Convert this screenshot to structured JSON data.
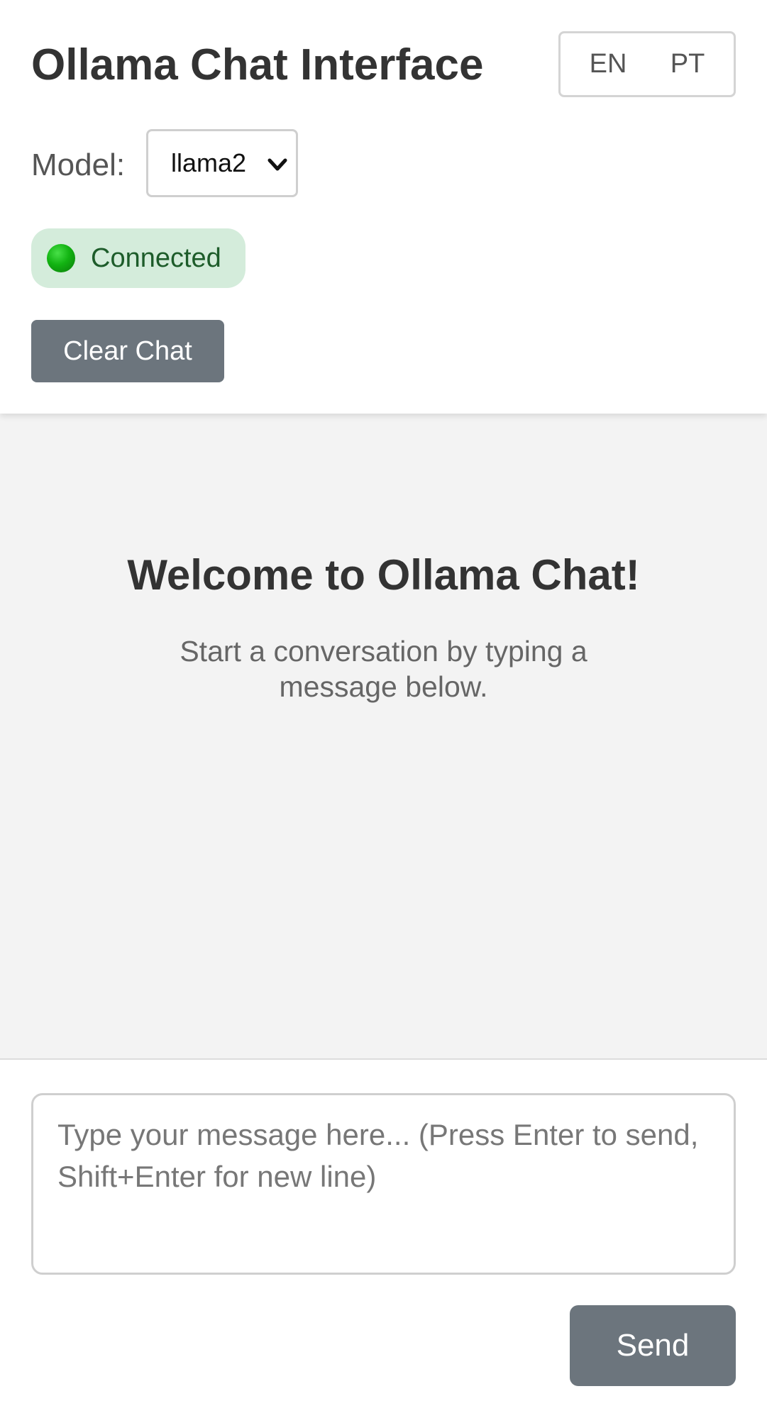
{
  "header": {
    "title": "Ollama Chat Interface",
    "languages": [
      "EN",
      "PT"
    ],
    "model_label": "Model:",
    "model_selected": "llama2",
    "status": {
      "text": "Connected",
      "color": "#12b312",
      "background": "#d4ecdb"
    },
    "clear_button": "Clear Chat"
  },
  "chat": {
    "welcome_title": "Welcome to Ollama Chat!",
    "welcome_subtitle": "Start a conversation by typing a message below."
  },
  "composer": {
    "placeholder": "Type your message here... (Press Enter to send, Shift+Enter for new line)",
    "send_button": "Send"
  },
  "colors": {
    "button_bg": "#6c757d",
    "chat_bg": "#f3f3f3"
  }
}
